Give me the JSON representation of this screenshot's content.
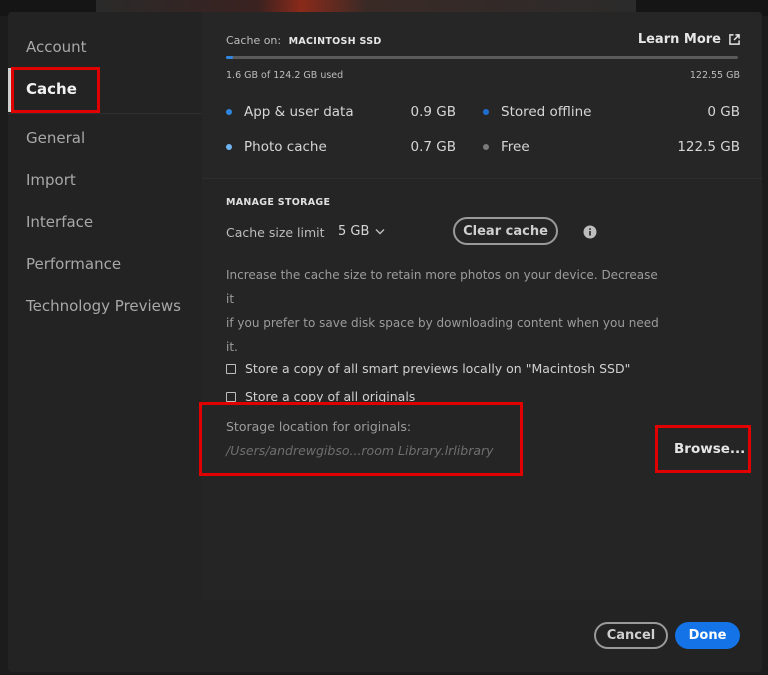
{
  "sidebar": {
    "items": [
      {
        "label": "Account"
      },
      {
        "label": "Cache"
      },
      {
        "label": "General"
      },
      {
        "label": "Import"
      },
      {
        "label": "Interface"
      },
      {
        "label": "Performance"
      },
      {
        "label": "Technology Previews"
      }
    ],
    "active": "Cache"
  },
  "cache": {
    "cache_on_label": "Cache on:",
    "drive_name": "MACINTOSH SSD",
    "learn_more": "Learn More",
    "used_text": "1.6 GB of 124.2 GB used",
    "total_text": "122.55 GB",
    "usage_fraction": 0.013,
    "stats": [
      {
        "label": "App & user data",
        "value": "0.9 GB",
        "color": "#2f86e0"
      },
      {
        "label": "Photo cache",
        "value": "0.7 GB",
        "color": "#6fb4f2"
      },
      {
        "label": "Stored offline",
        "value": "0 GB",
        "color": "#1f6fd0"
      },
      {
        "label": "Free",
        "value": "122.5 GB",
        "color": "#7a7a7a"
      }
    ]
  },
  "manage": {
    "title": "MANAGE STORAGE",
    "limit_label": "Cache size limit",
    "limit_value": "5 GB",
    "clear_button": "Clear cache",
    "help_line1": "Increase the cache size to retain more photos on your device. Decrease it",
    "help_line2": "if you prefer to save disk space by downloading content when you need it.",
    "checkbox_smart_previews": "Store a copy of all smart previews locally on \"Macintosh SSD\"",
    "checkbox_originals": "Store a copy of all originals",
    "location_label": "Storage location for originals:",
    "location_path": "/Users/andrewgibso...room Library.lrlibrary",
    "browse_button": "Browse..."
  },
  "footer": {
    "cancel": "Cancel",
    "done": "Done"
  },
  "colors": {
    "accent": "#1473e6",
    "highlight": "#e00000"
  }
}
